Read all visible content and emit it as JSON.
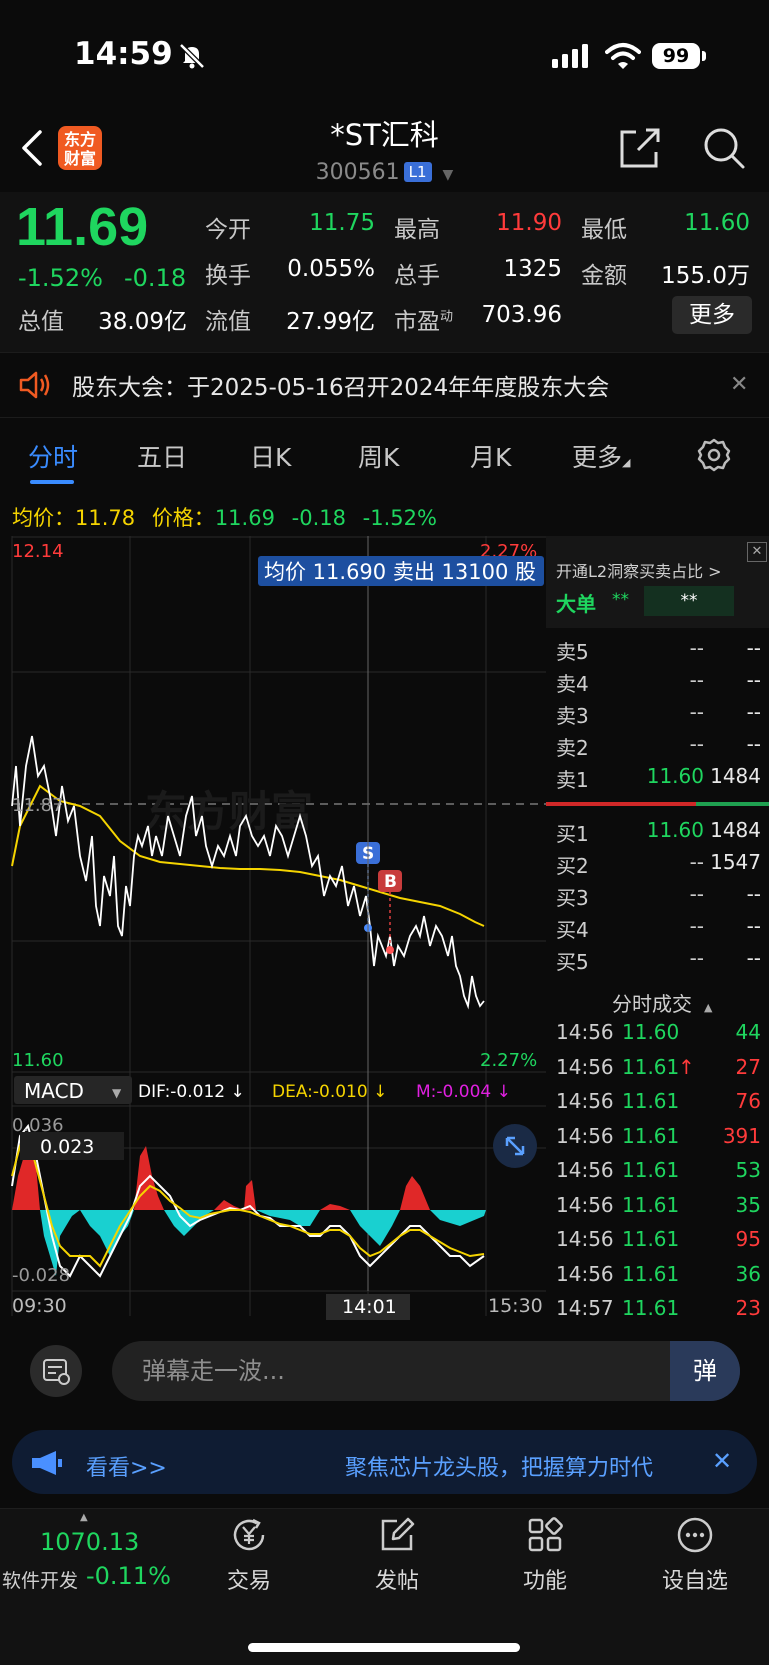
{
  "status_bar": {
    "time": "14:59",
    "battery": "99"
  },
  "header": {
    "logo_line1": "东方",
    "logo_line2": "财富",
    "stock_name": "*ST汇科",
    "stock_code": "300561",
    "level_badge": "L1"
  },
  "quote": {
    "price": "11.69",
    "change_pct": "-1.52%",
    "change": "-0.18",
    "fields": [
      {
        "label": "今开",
        "value": "11.75",
        "color": "#1fd65f"
      },
      {
        "label": "最高",
        "value": "11.90",
        "color": "#ff3b3b"
      },
      {
        "label": "最低",
        "value": "11.60",
        "color": "#1fd65f"
      },
      {
        "label": "换手",
        "value": "0.055%",
        "color": "#ffffff"
      },
      {
        "label": "总手",
        "value": "1325",
        "color": "#ffffff"
      },
      {
        "label": "金额",
        "value": "155.0万",
        "color": "#ffffff"
      },
      {
        "label": "总值",
        "value": "38.09亿",
        "color": "#ffffff"
      },
      {
        "label": "流值",
        "value": "27.99亿",
        "color": "#ffffff"
      },
      {
        "label": "市盈",
        "label_sup": "动",
        "value": "703.96",
        "color": "#ffffff"
      }
    ],
    "more_label": "更多"
  },
  "notice": {
    "text": "股东大会：于2025-05-16召开2024年年度股东大会"
  },
  "tabs": [
    "分时",
    "五日",
    "日K",
    "周K",
    "月K",
    "更多"
  ],
  "info_line": {
    "avg_label": "均价：",
    "avg_value": "11.78",
    "price_label": "价格：",
    "price_value": "11.69",
    "chg": "-0.18",
    "pct": "-1.52%"
  },
  "chart": {
    "y_top_label": "12.14",
    "y_top_pct": "2.27%",
    "y_mid_label": "11.87",
    "y_bottom_label": "11.60",
    "y_bottom_pct": "2.27%",
    "watermark": "东方财富",
    "tooltip": "均价 11.690 卖出 13100 股",
    "marker_s": "S",
    "marker_b": "B",
    "macd_label": "MACD",
    "dif": "DIF:-0.012 ↓",
    "dea": "DEA:-0.010 ↓",
    "m": "M:-0.004 ↓",
    "macd_top": "0.036",
    "macd_cursor": "0.023",
    "macd_bottom": "-0.028",
    "time_start": "09:30",
    "time_cursor": "14:01",
    "time_end": "15:30"
  },
  "order_book": {
    "l2_promo": "开通L2洞察买卖占比 >",
    "big_order_label": "大单",
    "big_order_val1": "**",
    "big_order_val2": "**",
    "asks": [
      {
        "label": "卖5",
        "price": "--",
        "vol": "--"
      },
      {
        "label": "卖4",
        "price": "--",
        "vol": "--"
      },
      {
        "label": "卖3",
        "price": "--",
        "vol": "--"
      },
      {
        "label": "卖2",
        "price": "--",
        "vol": "--"
      },
      {
        "label": "卖1",
        "price": "11.60",
        "vol": "1484"
      }
    ],
    "bids": [
      {
        "label": "买1",
        "price": "11.60",
        "vol": "1484"
      },
      {
        "label": "买2",
        "price": "--",
        "vol": "1547"
      },
      {
        "label": "买3",
        "price": "--",
        "vol": "--"
      },
      {
        "label": "买4",
        "price": "--",
        "vol": "--"
      },
      {
        "label": "买5",
        "price": "--",
        "vol": "--"
      }
    ],
    "trades_title": "分时成交",
    "trades": [
      {
        "time": "14:56",
        "price": "11.60",
        "vol": "44",
        "vol_color": "#1fd65f",
        "arrow": ""
      },
      {
        "time": "14:56",
        "price": "11.61",
        "vol": "27",
        "vol_color": "#ff3b3b",
        "arrow": "↑"
      },
      {
        "time": "14:56",
        "price": "11.61",
        "vol": "76",
        "vol_color": "#ff3b3b",
        "arrow": ""
      },
      {
        "time": "14:56",
        "price": "11.61",
        "vol": "391",
        "vol_color": "#ff3b3b",
        "arrow": ""
      },
      {
        "time": "14:56",
        "price": "11.61",
        "vol": "53",
        "vol_color": "#1fd65f",
        "arrow": ""
      },
      {
        "time": "14:56",
        "price": "11.61",
        "vol": "35",
        "vol_color": "#1fd65f",
        "arrow": ""
      },
      {
        "time": "14:56",
        "price": "11.61",
        "vol": "95",
        "vol_color": "#ff3b3b",
        "arrow": ""
      },
      {
        "time": "14:56",
        "price": "11.61",
        "vol": "36",
        "vol_color": "#1fd65f",
        "arrow": ""
      },
      {
        "time": "14:57",
        "price": "11.61",
        "vol": "23",
        "vol_color": "#ff3b3b",
        "arrow": ""
      }
    ]
  },
  "danmaku": {
    "placeholder": "弹幕走一波...",
    "send_label": "弹"
  },
  "ad": {
    "left_text": "看看>>",
    "text": "聚焦芯片龙头股，把握算力时代"
  },
  "bottom": {
    "index_value": "1070.13",
    "index_name": "软件开发",
    "index_pct": "-0.11%",
    "nav": [
      "交易",
      "发帖",
      "功能",
      "设自选"
    ]
  }
}
